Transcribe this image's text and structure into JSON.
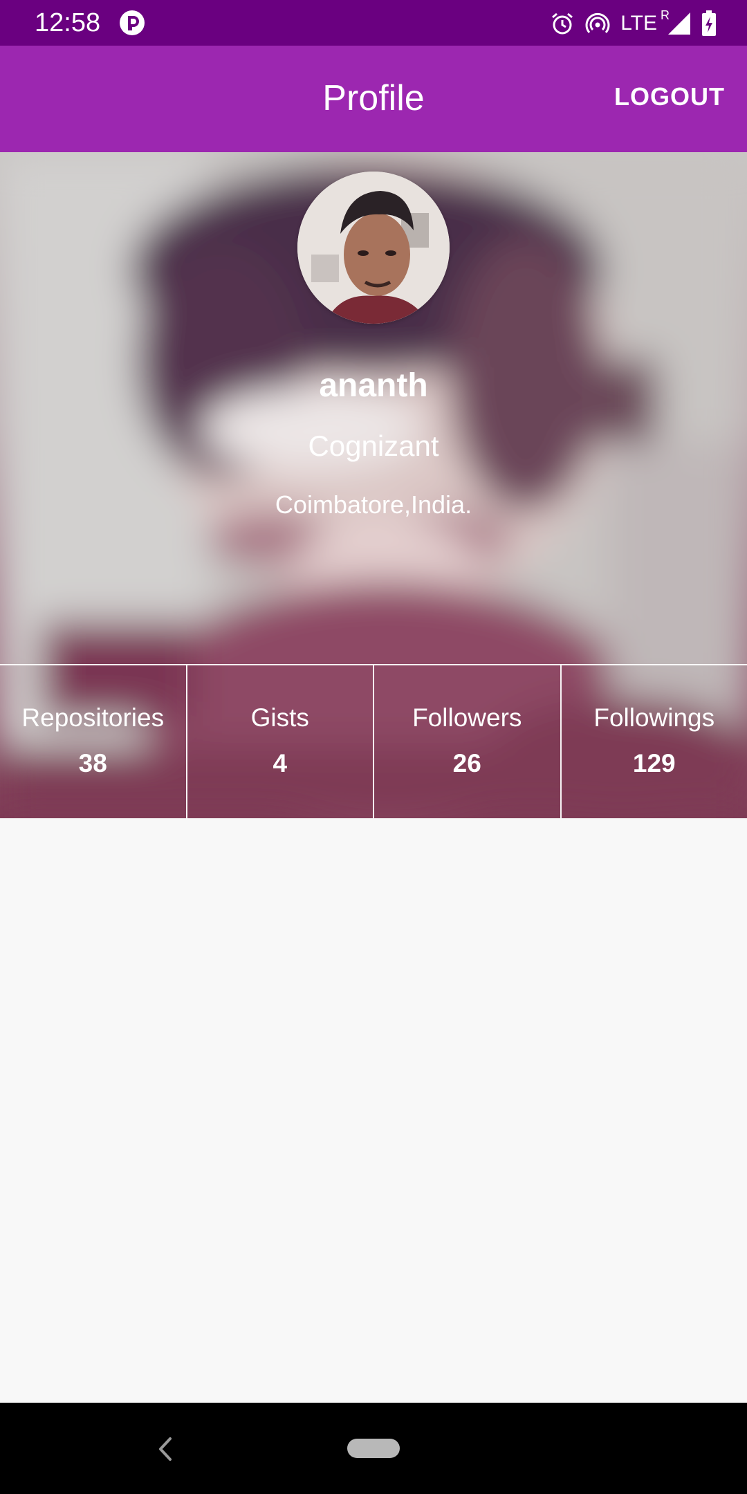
{
  "status_bar": {
    "time": "12:58",
    "app_icon": "app-notification-icon",
    "icons": [
      "alarm-icon",
      "hotspot-icon",
      "signal-icon",
      "battery-icon"
    ],
    "network_label": "LTE",
    "roaming_label": "R"
  },
  "app_bar": {
    "title": "Profile",
    "logout_label": "LOGOUT",
    "color": "#9c27b0",
    "status_color": "#6a0080"
  },
  "profile": {
    "name": "ananth",
    "company": "Cognizant",
    "location": "Coimbatore,India."
  },
  "stats": [
    {
      "label": "Repositories",
      "value": "38"
    },
    {
      "label": "Gists",
      "value": "4"
    },
    {
      "label": "Followers",
      "value": "26"
    },
    {
      "label": "Followings",
      "value": "129"
    }
  ],
  "nav_bar": {
    "icons": [
      "back-icon",
      "home-pill-icon"
    ]
  }
}
